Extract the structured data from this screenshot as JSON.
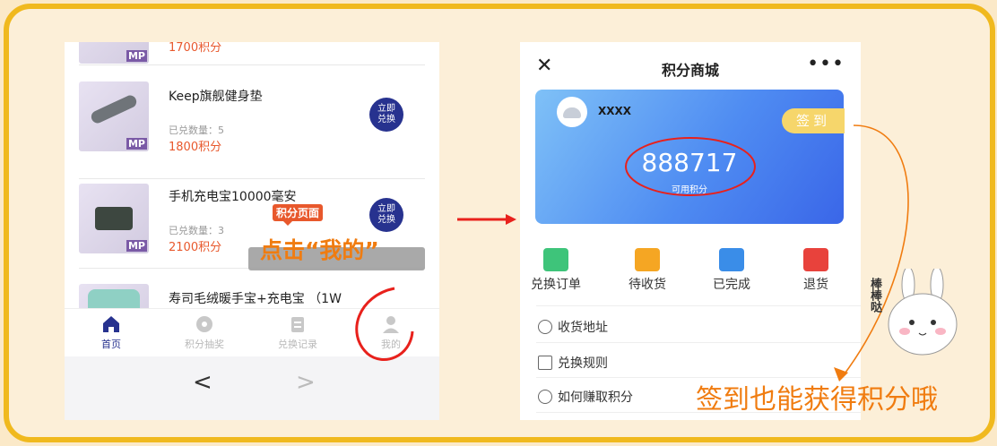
{
  "left_phone": {
    "products": [
      {
        "title": "",
        "qty": "",
        "points": "1700积分"
      },
      {
        "title": "Keep旗舰健身垫",
        "qty": "已兑数量：5",
        "points": "1800积分"
      },
      {
        "title": "手机充电宝10000毫安",
        "qty": "已兑数量：3",
        "points": "2100积分"
      },
      {
        "title": "寿司毛绒暖手宝+充电宝 （1W",
        "qty": "",
        "points": ""
      }
    ],
    "redeem_label": "立即\n兑换",
    "thumb_badge": "MP",
    "tabs": [
      {
        "label": "首页",
        "icon": "home-icon"
      },
      {
        "label": "积分抽奖",
        "icon": "lottery-icon"
      },
      {
        "label": "兑换记录",
        "icon": "record-icon"
      },
      {
        "label": "我的",
        "icon": "user-icon"
      }
    ],
    "nav": {
      "back": "<",
      "forward": ">"
    }
  },
  "annotations": {
    "bubble": "积分页面",
    "tap_hint": "点击“我的”",
    "caption": "签到也能获得积分哦",
    "praise": "棒棒哒"
  },
  "right_phone": {
    "title": "积分商城",
    "close": "✕",
    "more": "•••",
    "user_name": "XXXX",
    "sign_in": "签到",
    "points": "888717",
    "points_label": "可用积分",
    "order_tabs": [
      {
        "label": "兑换订单",
        "icon": "exchange-order-icon",
        "color": "#3ec47a"
      },
      {
        "label": "待收货",
        "icon": "truck-icon",
        "color": "#f5a623"
      },
      {
        "label": "已完成",
        "icon": "completed-icon",
        "color": "#3a8de8"
      },
      {
        "label": "退货",
        "icon": "return-icon",
        "color": "#e8423c"
      }
    ],
    "menu": [
      {
        "label": "收货地址",
        "icon": "location-icon"
      },
      {
        "label": "兑换规则",
        "icon": "gift-icon"
      },
      {
        "label": "如何赚取积分",
        "icon": "info-icon"
      }
    ]
  },
  "colors": {
    "accent_orange": "#f07c10",
    "brand_blue": "#27328f",
    "frame_yellow": "#f0b91e"
  }
}
